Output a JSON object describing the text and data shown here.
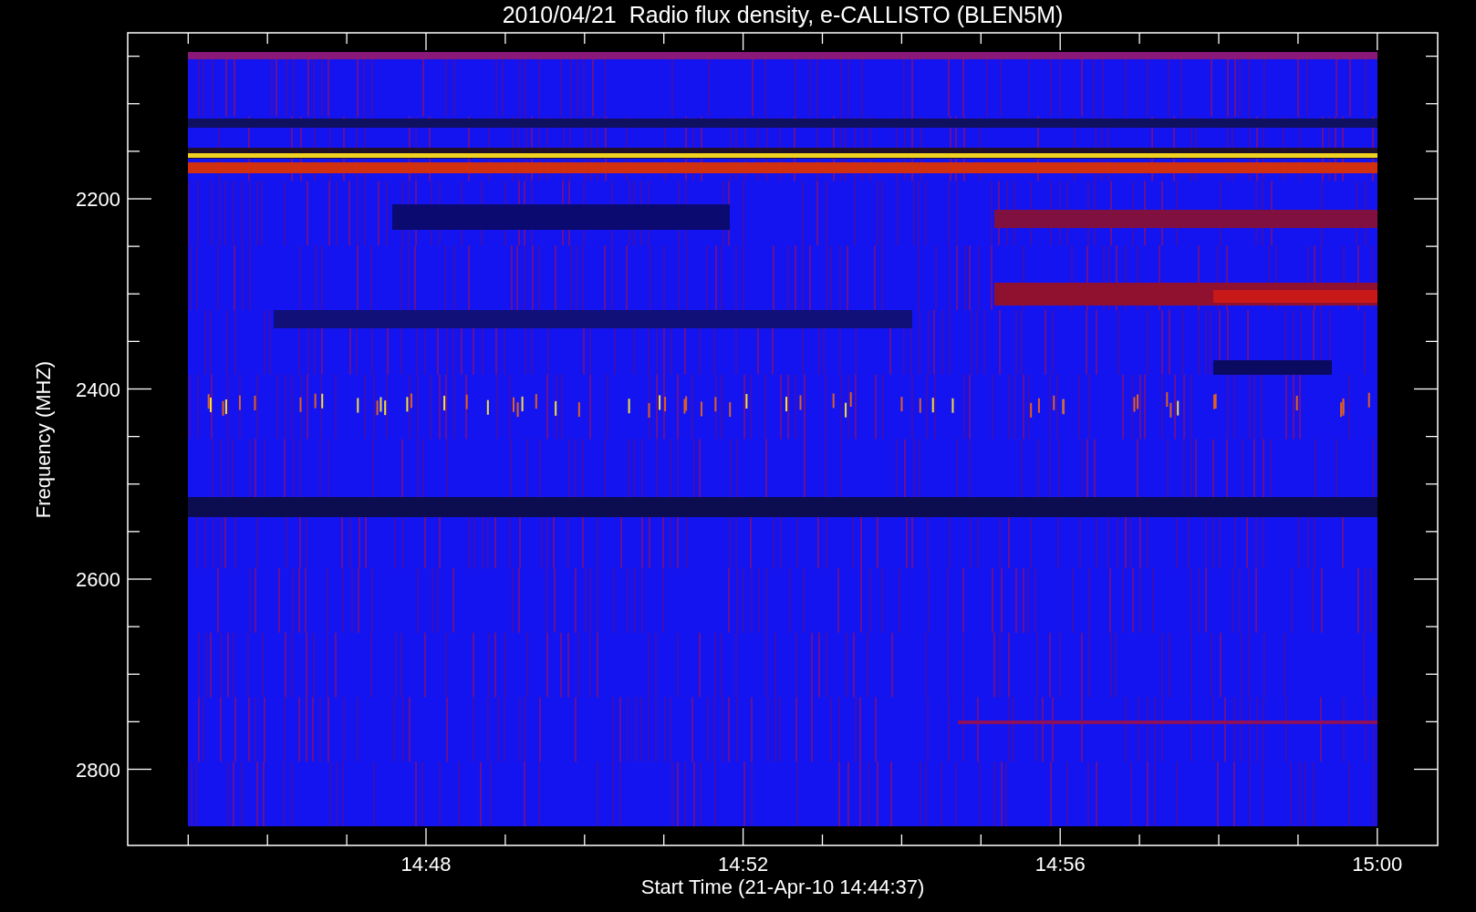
{
  "title": "2010/04/21  Radio flux density, e-CALLISTO (BLEN5M)",
  "y_axis": {
    "label": "Frequency (MHZ)",
    "ticks": [
      "2200",
      "2400",
      "2600",
      "2800"
    ]
  },
  "x_axis": {
    "label": "Start Time (21-Apr-10 14:44:37)",
    "ticks": [
      "14:48",
      "14:52",
      "14:56",
      "15:00"
    ]
  }
}
